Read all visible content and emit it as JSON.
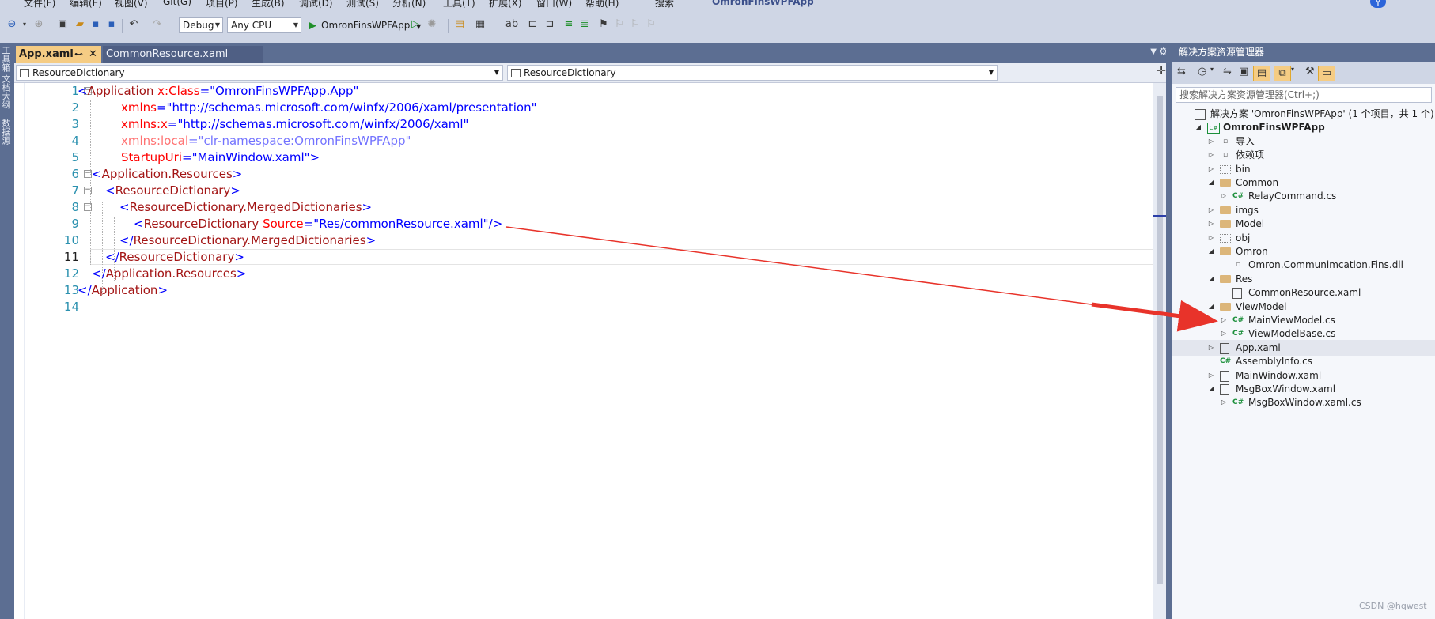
{
  "menu": [
    "文件(F)",
    "编辑(E)",
    "视图(V)",
    "Git(G)",
    "项目(P)",
    "生成(B)",
    "调试(D)",
    "测试(S)",
    "分析(N)",
    "工具(T)",
    "扩展(X)",
    "窗口(W)",
    "帮助(H)",
    "搜索"
  ],
  "window_title": "OmronFinsWPFApp",
  "avatar_letter": "Y",
  "toolbar": {
    "config": "Debug",
    "platform": "Any CPU",
    "start_label": "OmronFinsWPFApp"
  },
  "left_strip": [
    "工具箱",
    "文档大纲",
    "数据源"
  ],
  "tabs": [
    {
      "label": "App.xaml",
      "active": true,
      "pin": "⊷",
      "close": "✕"
    },
    {
      "label": "CommonResource.xaml",
      "active": false
    }
  ],
  "nav": {
    "left": "ResourceDictionary",
    "right": "ResourceDictionary"
  },
  "editor": {
    "lines": [
      {
        "n": "1",
        "html": "<span class='t-b'>&lt;</span><span class='t-r'>Application</span> <span class='t-a'>x:Class</span><span class='t-b'>=\"OmronFinsWPFApp.App\"</span>"
      },
      {
        "n": "2",
        "html": "<span class='t-a'>xmlns</span><span class='t-b'>=\"http://schemas.microsoft.com/winfx/2006/xaml/presentation\"</span>"
      },
      {
        "n": "3",
        "html": "<span class='t-a'>xmlns:x</span><span class='t-b'>=\"http://schemas.microsoft.com/winfx/2006/xaml\"</span>"
      },
      {
        "n": "4",
        "html": "<span class='dim'><span class='t-a'>xmlns:local</span><span class='t-b'>=\"clr-namespace:OmronFinsWPFApp\"</span></span>"
      },
      {
        "n": "5",
        "html": "<span class='t-a'>StartupUri</span><span class='t-b'>=\"MainWindow.xaml\"&gt;</span>"
      },
      {
        "n": "6",
        "html": "<span class='t-b'>&lt;</span><span class='t-r'>Application.Resources</span><span class='t-b'>&gt;</span>"
      },
      {
        "n": "7",
        "html": "<span class='t-b'>&lt;</span><span class='t-r'>ResourceDictionary</span><span class='t-b'>&gt;</span>"
      },
      {
        "n": "8",
        "html": "<span class='t-b'>&lt;</span><span class='t-r'>ResourceDictionary.MergedDictionaries</span><span class='t-b'>&gt;</span>"
      },
      {
        "n": "9",
        "html": "<span class='t-b'>&lt;</span><span class='t-r'>ResourceDictionary</span> <span class='t-a'>Source</span><span class='t-b'>=\"Res/commonResource.xaml\"/&gt;</span>"
      },
      {
        "n": "10",
        "html": "<span class='t-b'>&lt;/</span><span class='t-r'>ResourceDictionary.MergedDictionaries</span><span class='t-b'>&gt;</span>"
      },
      {
        "n": "11",
        "html": "<span class='t-b'>&lt;/</span><span class='t-r'>ResourceDictionary</span><span class='t-b'>&gt;</span>"
      },
      {
        "n": "12",
        "html": "<span class='t-b'>&lt;/</span><span class='t-r'>Application.Resources</span><span class='t-b'>&gt;</span>"
      },
      {
        "n": "13",
        "html": "<span class='t-b'>&lt;/</span><span class='t-r'>Application</span><span class='t-b'>&gt;</span>"
      },
      {
        "n": "14",
        "html": ""
      }
    ],
    "current_line": "11"
  },
  "solution_explorer": {
    "title": "解决方案资源管理器",
    "search_placeholder": "搜索解决方案资源管理器(Ctrl+;)",
    "nodes": [
      {
        "label": "解决方案 'OmronFinsWPFApp' (1 个项目，共 1 个)",
        "icon": "sln",
        "expander": "",
        "bold": false
      },
      {
        "label": "OmronFinsWPFApp",
        "icon": "csproj",
        "expander": "◢",
        "bold": true
      },
      {
        "label": "导入",
        "icon": "plain",
        "expander": "▷",
        "bold": false
      },
      {
        "label": "依赖项",
        "icon": "plain",
        "expander": "▷",
        "bold": false
      },
      {
        "label": "bin",
        "icon": "folderg",
        "expander": "▷",
        "bold": false
      },
      {
        "label": "Common",
        "icon": "folder",
        "expander": "◢",
        "bold": false
      },
      {
        "label": "RelayCommand.cs",
        "icon": "cs",
        "expander": "▷",
        "bold": false
      },
      {
        "label": "imgs",
        "icon": "folder",
        "expander": "▷",
        "bold": false
      },
      {
        "label": "Model",
        "icon": "folder",
        "expander": "▷",
        "bold": false
      },
      {
        "label": "obj",
        "icon": "folderg",
        "expander": "▷",
        "bold": false
      },
      {
        "label": "Omron",
        "icon": "folder",
        "expander": "◢",
        "bold": false
      },
      {
        "label": "Omron.Communimcation.Fins.dll",
        "icon": "plain",
        "expander": "",
        "bold": false
      },
      {
        "label": "Res",
        "icon": "folder",
        "expander": "◢",
        "bold": false
      },
      {
        "label": "CommonResource.xaml",
        "icon": "xaml",
        "expander": "",
        "bold": false
      },
      {
        "label": "ViewModel",
        "icon": "folder",
        "expander": "◢",
        "bold": false
      },
      {
        "label": "MainViewModel.cs",
        "icon": "cs",
        "expander": "▷",
        "bold": false
      },
      {
        "label": "ViewModelBase.cs",
        "icon": "cs",
        "expander": "▷",
        "bold": false
      },
      {
        "label": "App.xaml",
        "icon": "xaml",
        "expander": "▷",
        "bold": false
      },
      {
        "label": "AssemblyInfo.cs",
        "icon": "cs",
        "expander": "",
        "bold": false
      },
      {
        "label": "MainWindow.xaml",
        "icon": "xaml",
        "expander": "▷",
        "bold": false
      },
      {
        "label": "MsgBoxWindow.xaml",
        "icon": "xaml",
        "expander": "◢",
        "bold": false
      },
      {
        "label": "MsgBoxWindow.xaml.cs",
        "icon": "cs",
        "expander": "▷",
        "bold": false
      }
    ]
  },
  "watermark": "CSDN @hqwest",
  "colors": {
    "accent_tab": "#f5cc84",
    "chrome": "#5c6e92",
    "annotation_arrow": "#e8332a"
  }
}
